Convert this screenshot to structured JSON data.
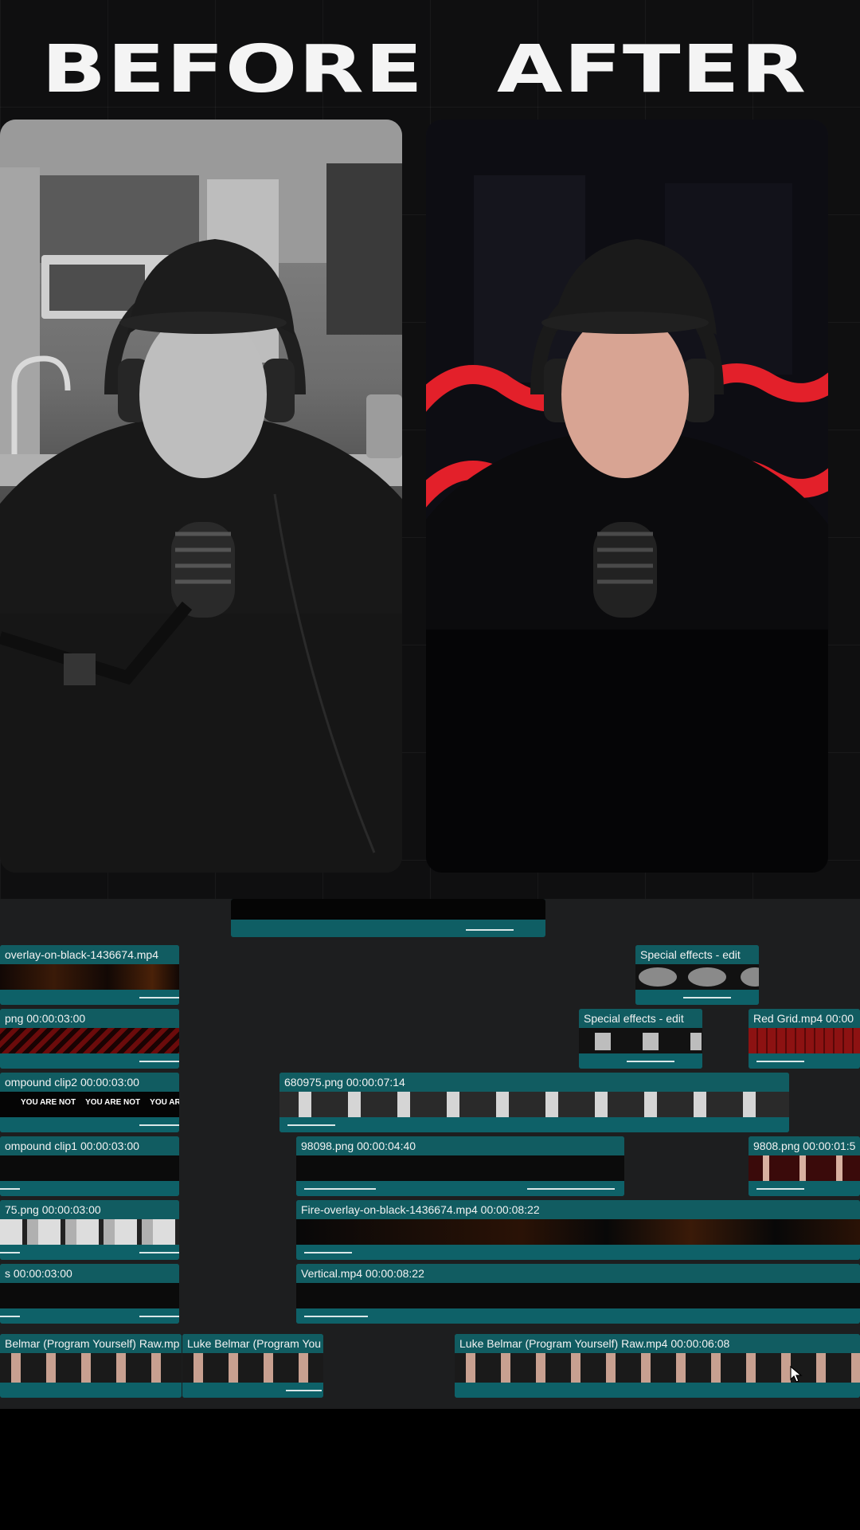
{
  "headings": {
    "before": "BEFORE",
    "after": "AFTER"
  },
  "timeline": {
    "clips": [
      {
        "id": "fire-overlay-top",
        "label": "overlay-on-black-1436674.mp4"
      },
      {
        "id": "special-effects-1",
        "label": "Special effects - edit"
      },
      {
        "id": "png-left",
        "label": "png  00:00:03:00"
      },
      {
        "id": "special-effects-2",
        "label": "Special effects - edit"
      },
      {
        "id": "red-grid",
        "label": "Red Grid.mp4  00:00"
      },
      {
        "id": "compound-clip2",
        "label": "ompound clip2  00:00:03:00"
      },
      {
        "id": "680975",
        "label": "680975.png  00:00:07:14"
      },
      {
        "id": "compound-clip1",
        "label": "ompound clip1  00:00:03:00"
      },
      {
        "id": "98098",
        "label": "98098.png  00:00:04:40"
      },
      {
        "id": "9808",
        "label": "9808.png  00:00:01:5"
      },
      {
        "id": "75png",
        "label": "75.png  00:00:03:00"
      },
      {
        "id": "fire-overlay-main",
        "label": "Fire-overlay-on-black-1436674.mp4  00:00:08:22"
      },
      {
        "id": "s-clip",
        "label": "s  00:00:03:00"
      },
      {
        "id": "vertical",
        "label": "Vertical.mp4  00:00:08:22"
      },
      {
        "id": "raw-1",
        "label": "Belmar (Program Yourself) Raw.mp"
      },
      {
        "id": "raw-2",
        "label": "Luke Belmar (Program You"
      },
      {
        "id": "raw-3",
        "label": "Luke Belmar (Program Yourself) Raw.mp4  00:00:06:08"
      }
    ],
    "text_overlay": "YOU ARE NOT"
  },
  "colors": {
    "clip": "#0f5e64",
    "accent_red": "#e3202a",
    "timeline_bg": "#1d1e1f"
  }
}
